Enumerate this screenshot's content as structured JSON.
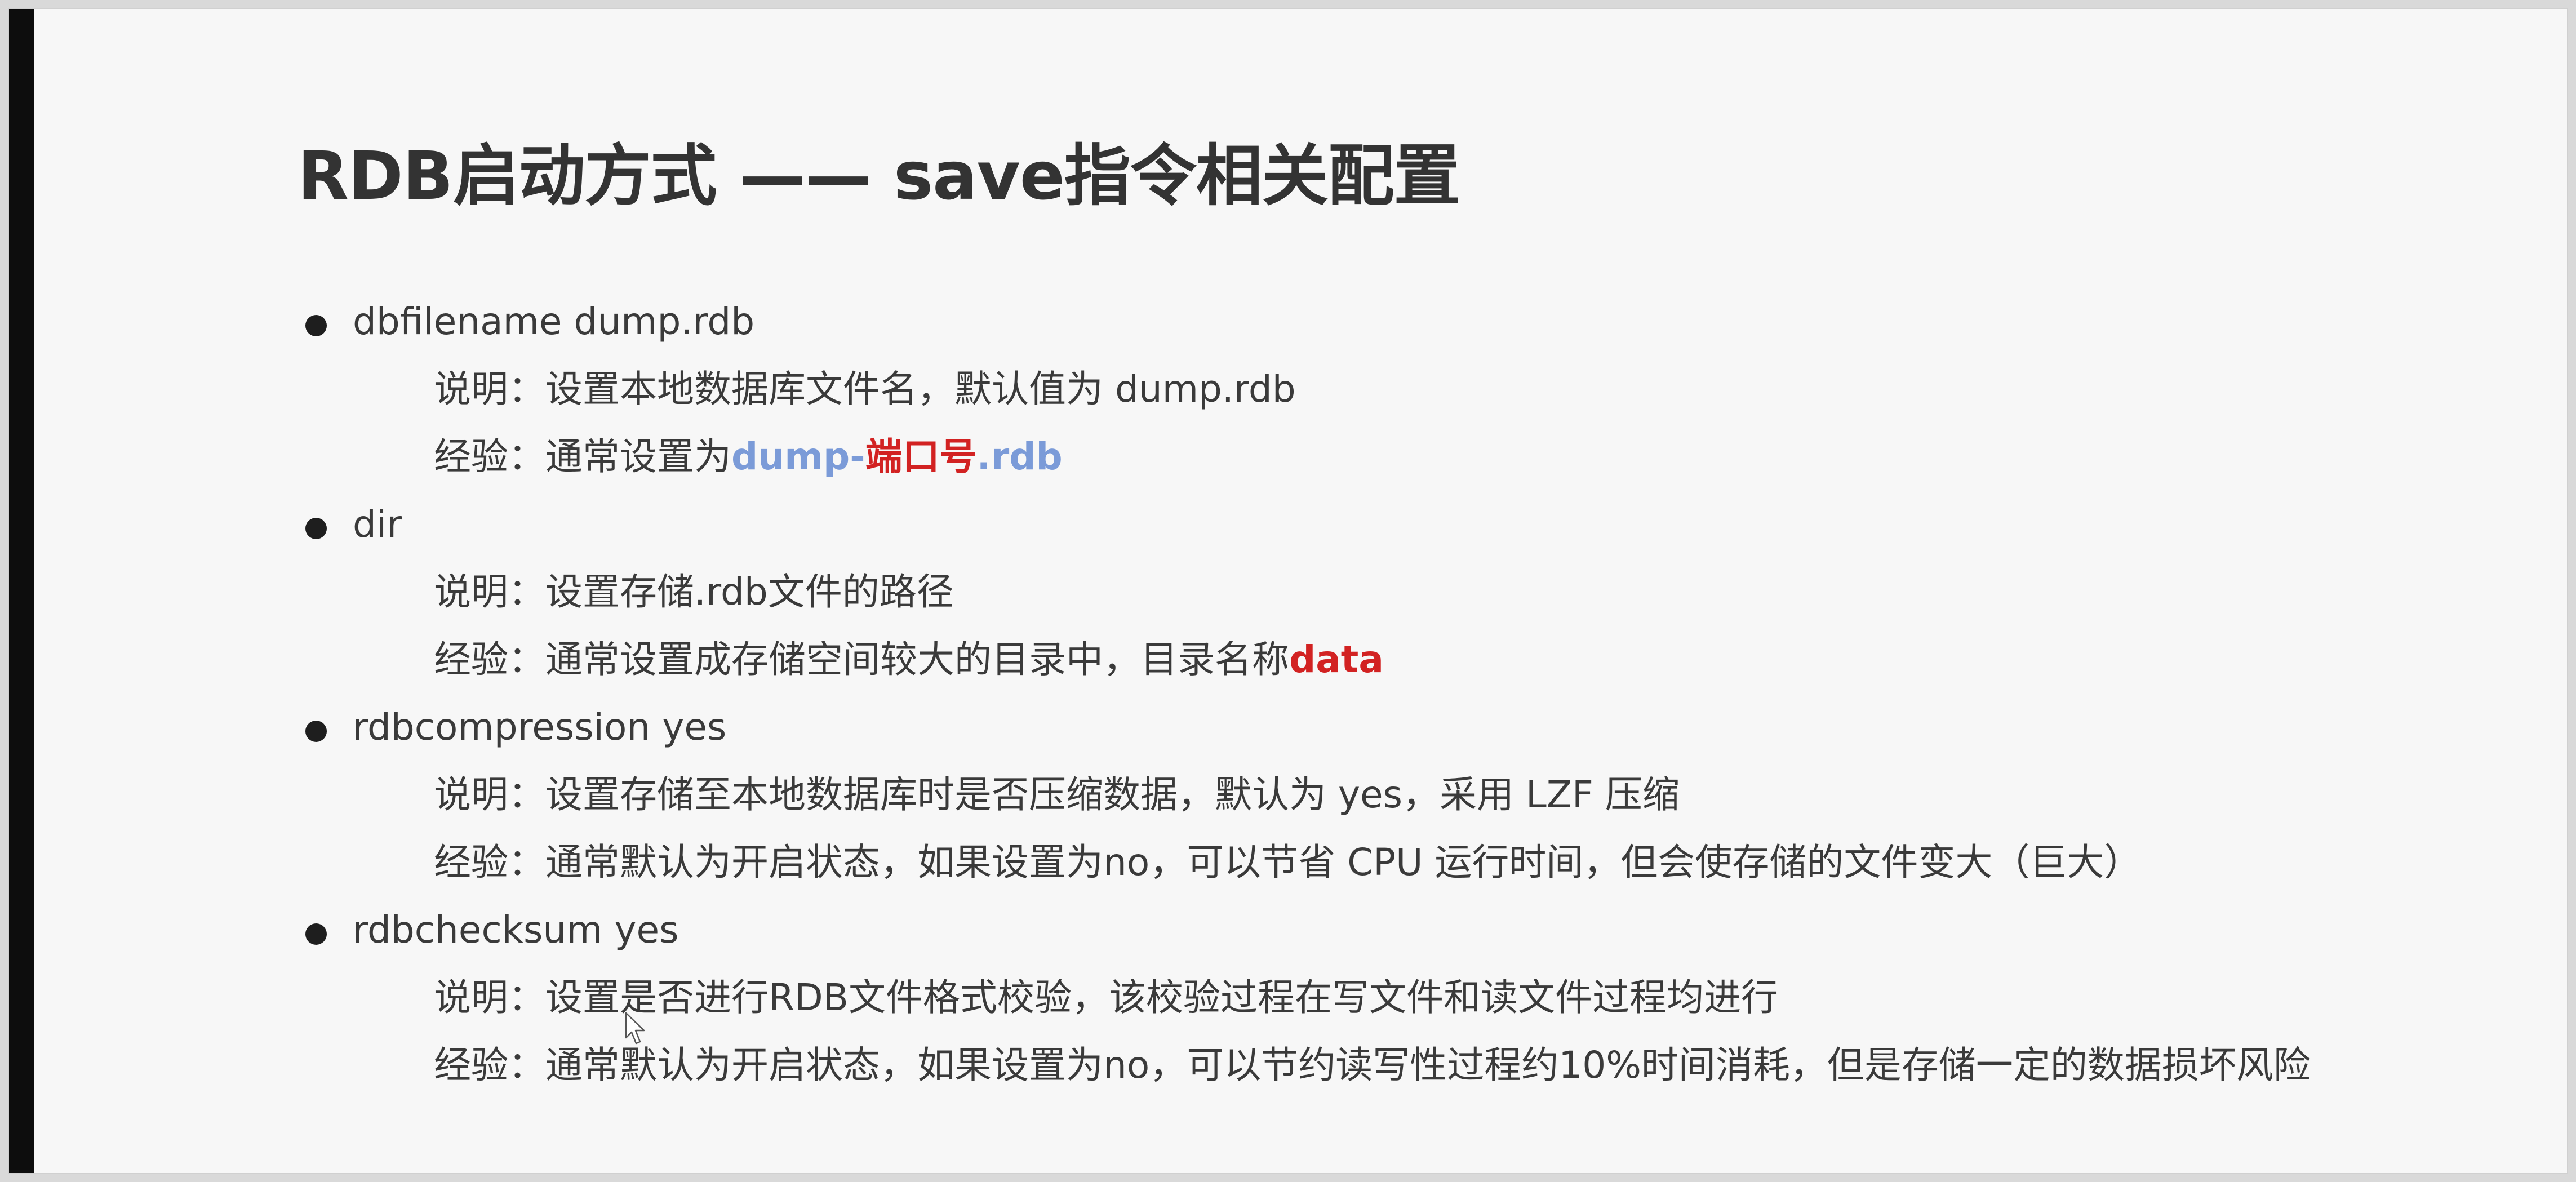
{
  "slide": {
    "title": "RDB启动方式 —— save指令相关配置",
    "items": [
      {
        "head": "dbfilename dump.rdb",
        "desc_label": "说明：",
        "desc_text": "设置本地数据库文件名，默认值为 dump.rdb",
        "exp_label": "经验：",
        "exp_text": "通常设置为",
        "exp_hl_1": "dump-",
        "exp_hl_2": "端口号",
        "exp_hl_3": ".rdb"
      },
      {
        "head": "dir",
        "desc_label": "说明：",
        "desc_text": "设置存储.rdb文件的路径",
        "exp_label": "经验：",
        "exp_text": "通常设置成存储空间较大的目录中，目录名称",
        "exp_hl": "data"
      },
      {
        "head": "rdbcompression yes",
        "desc_label": "说明：",
        "desc_text": "设置存储至本地数据库时是否压缩数据，默认为 yes，采用 LZF 压缩",
        "exp_label": "经验：",
        "exp_text": "通常默认为开启状态，如果设置为no，可以节省 CPU 运行时间，但会使存储的文件变大（巨大）"
      },
      {
        "head": "rdbchecksum yes",
        "desc_label": "说明：",
        "desc_text": "设置是否进行RDB文件格式校验，该校验过程在写文件和读文件过程均进行",
        "exp_label": "经验：",
        "exp_text": "通常默认为开启状态，如果设置为no，可以节约读写性过程约10%时间消耗，但是存储一定的数据损坏风险"
      }
    ]
  },
  "colors": {
    "blue_highlight": "#7b9bd8",
    "red_highlight": "#d22222",
    "text": "#3a3a3a",
    "title": "#333333"
  }
}
